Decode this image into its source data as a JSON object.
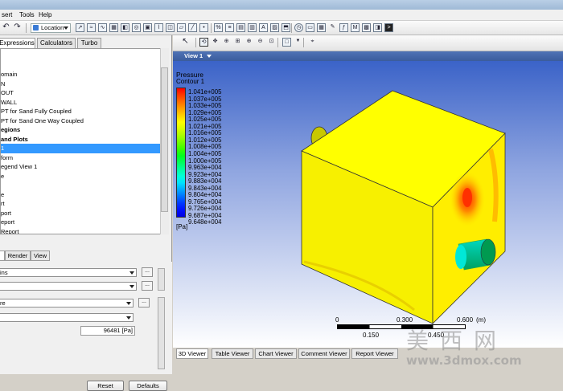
{
  "menubar": {
    "items": [
      "sert",
      "Tools",
      "Help"
    ]
  },
  "toolbar": {
    "location_label": "Location"
  },
  "left_tabs": [
    "Expressions",
    "Calculators",
    "Turbo"
  ],
  "tree": {
    "rows": [
      {
        "label": "omain",
        "bold": false,
        "selected": false
      },
      {
        "label": "N",
        "bold": false,
        "selected": false
      },
      {
        "label": "OUT",
        "bold": false,
        "selected": false
      },
      {
        "label": "WALL",
        "bold": false,
        "selected": false
      },
      {
        "label": "PT for Sand Fully Coupled",
        "bold": false,
        "selected": false
      },
      {
        "label": "PT for Sand One Way Coupled",
        "bold": false,
        "selected": false
      },
      {
        "label": "egions",
        "bold": true,
        "selected": false
      },
      {
        "label": "and Plots",
        "bold": true,
        "selected": false
      },
      {
        "label": "1",
        "bold": false,
        "selected": true
      },
      {
        "label": "form",
        "bold": false,
        "selected": false
      },
      {
        "label": "egend View 1",
        "bold": false,
        "selected": false
      },
      {
        "label": "e",
        "bold": false,
        "selected": false
      },
      {
        "label": "",
        "bold": false,
        "selected": false
      },
      {
        "label": "e",
        "bold": false,
        "selected": false
      },
      {
        "label": "rt",
        "bold": false,
        "selected": false
      },
      {
        "label": "port",
        "bold": false,
        "selected": false
      },
      {
        "label": "eport",
        "bold": false,
        "selected": false
      },
      {
        "label": "Report",
        "bold": false,
        "selected": false
      }
    ]
  },
  "detail_tabs": [
    "",
    "Render",
    "View"
  ],
  "details": {
    "combo1": "ins",
    "combo2": "",
    "combo3": "re",
    "combo4": "",
    "value": "96481 [Pa]",
    "reset_label": "Reset",
    "defaults_label": "Defaults"
  },
  "viewer": {
    "view_label": "View 1",
    "legend_title": "Pressure",
    "legend_subtitle": "Contour 1",
    "legend_values": [
      "1.041e+005",
      "1.037e+005",
      "1.033e+005",
      "1.029e+005",
      "1.025e+005",
      "1.021e+005",
      "1.016e+005",
      "1.012e+005",
      "1.008e+005",
      "1.004e+005",
      "1.000e+005",
      "9.963e+004",
      "9.923e+004",
      "9.883e+004",
      "9.843e+004",
      "9.804e+004",
      "9.765e+004",
      "9.726e+004",
      "9.687e+004",
      "9.648e+004"
    ],
    "legend_unit": "[Pa]",
    "legend_colors": [
      "#ff0000",
      "#ff3a00",
      "#ff6d00",
      "#ffa000",
      "#ffd000",
      "#ffff00",
      "#d8ff00",
      "#a8ff00",
      "#70ff00",
      "#38ff00",
      "#00ff20",
      "#00ff60",
      "#00ffa0",
      "#00ffd8",
      "#00e0ff",
      "#00a8ff",
      "#0070ff",
      "#0038ff",
      "#0010ff",
      "#0000e0"
    ],
    "scale_top": [
      "0",
      "0.300",
      "0.600",
      "(m)"
    ],
    "scale_bottom": [
      "0.150",
      "0.450"
    ]
  },
  "bottom_tabs": [
    "3D Viewer",
    "Table Viewer",
    "Chart Viewer",
    "Comment Viewer",
    "Report Viewer"
  ],
  "watermark": {
    "text": "美西网",
    "url": "www.3dmox.com"
  }
}
